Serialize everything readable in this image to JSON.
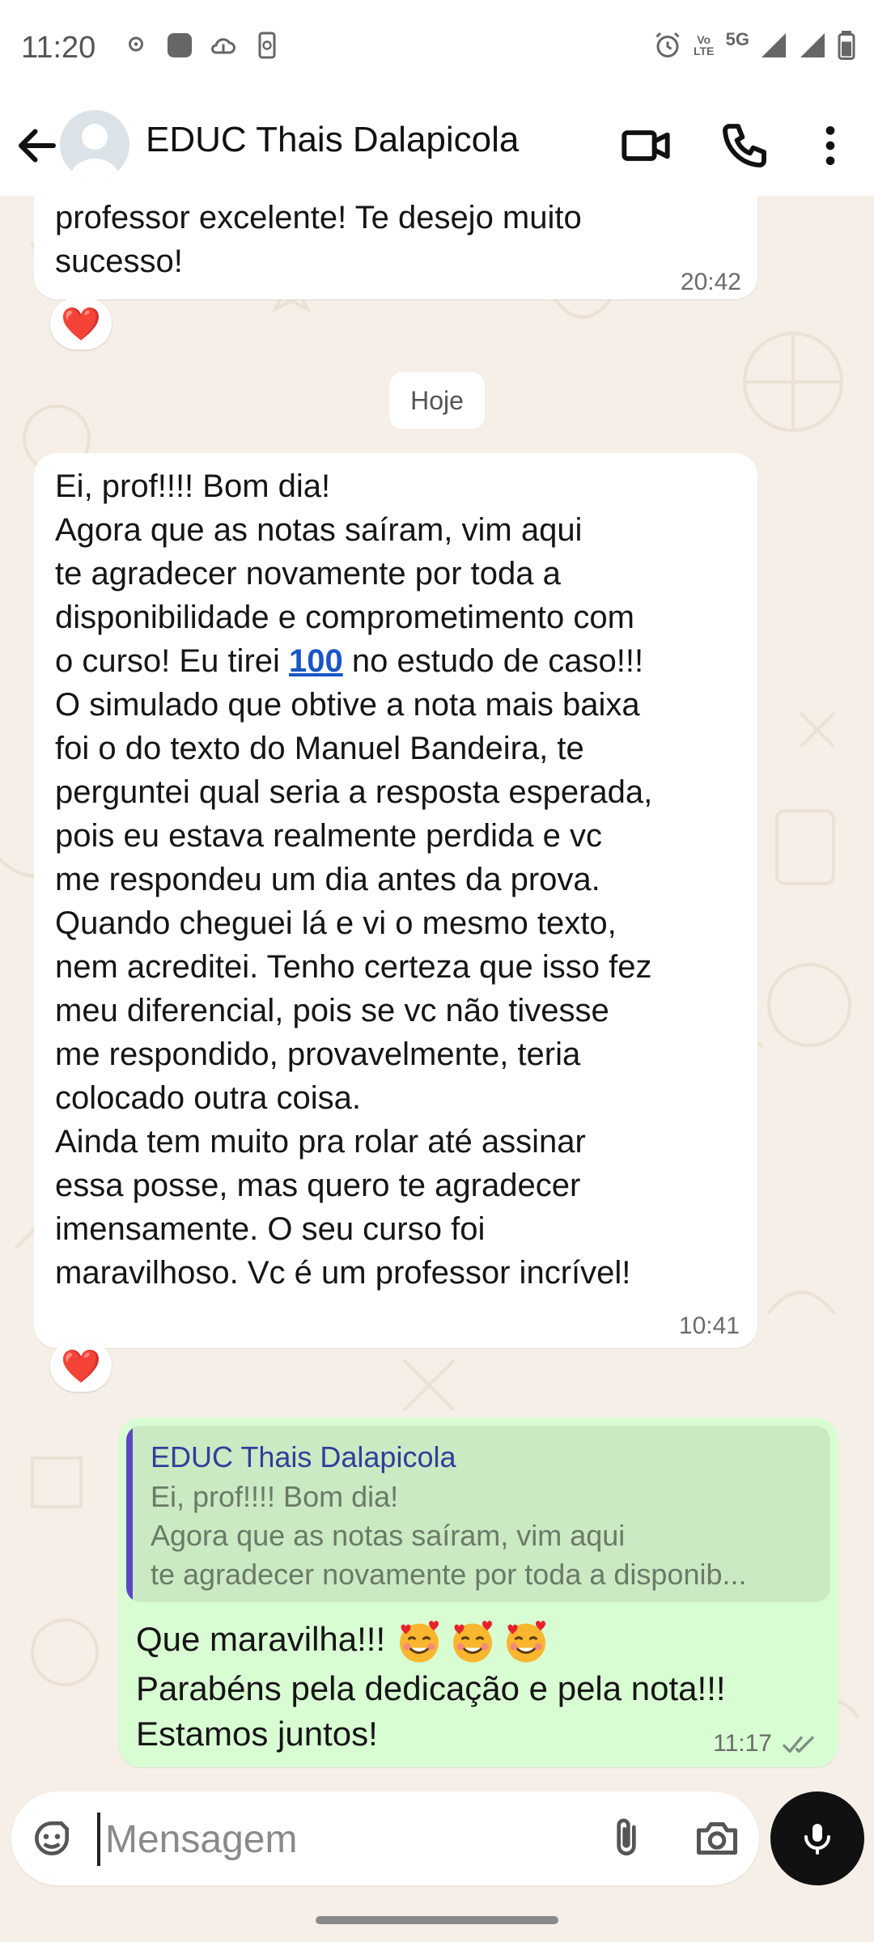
{
  "status_bar": {
    "time": "11:20",
    "network_label": "5G",
    "volte_label": "Vo LTE"
  },
  "header": {
    "contact_name": "EDUC Thais Dalapicola"
  },
  "messages": {
    "prev": {
      "lines": [
        "professor excelente! Te desejo muito",
        "sucesso!"
      ],
      "time": "20:42",
      "reaction": "❤️"
    },
    "date_divider": "Hoje",
    "main": {
      "lines_before_link": [
        "Ei, prof!!!! Bom dia!",
        "Agora que as notas saíram, vim aqui",
        "te agradecer novamente por toda a",
        "disponibilidade e comprometimento com"
      ],
      "link_line_prefix": "o curso! Eu tirei ",
      "link_value": "100",
      "link_line_suffix": " no estudo de caso!!!",
      "lines_after_link": [
        "O simulado que obtive a nota mais baixa",
        "foi o do texto do Manuel Bandeira, te",
        "perguntei qual seria a resposta esperada,",
        "pois eu estava realmente perdida e vc",
        "me respondeu um dia antes da prova.",
        "Quando cheguei lá e vi o mesmo texto,",
        "nem acreditei. Tenho certeza que isso fez",
        "meu diferencial, pois se vc não tivesse",
        "me respondido, provavelmente, teria",
        "colocado outra coisa.",
        "Ainda tem muito pra rolar até assinar",
        "essa posse, mas quero te agradecer",
        "imensamente. O seu curso foi",
        "maravilhoso. Vc é um professor incrível!"
      ],
      "time": "10:41",
      "reaction": "❤️"
    },
    "reply": {
      "quote_name": "EDUC Thais Dalapicola",
      "quote_lines": [
        "Ei, prof!!!! Bom dia!",
        "Agora que as notas saíram, vim aqui",
        "te agradecer novamente por toda a disponib..."
      ],
      "line1": "Que maravilha!!!",
      "line2": "Parabéns pela dedicação e pela nota!!!",
      "line3": "Estamos juntos!",
      "time": "11:17"
    }
  },
  "composer": {
    "placeholder": "Mensagem"
  },
  "colors": {
    "outgoing_bubble": "#d9fdd3",
    "quote_bar": "#5b47c6",
    "link": "#1a56c4",
    "reaction": "#e32d3c"
  }
}
